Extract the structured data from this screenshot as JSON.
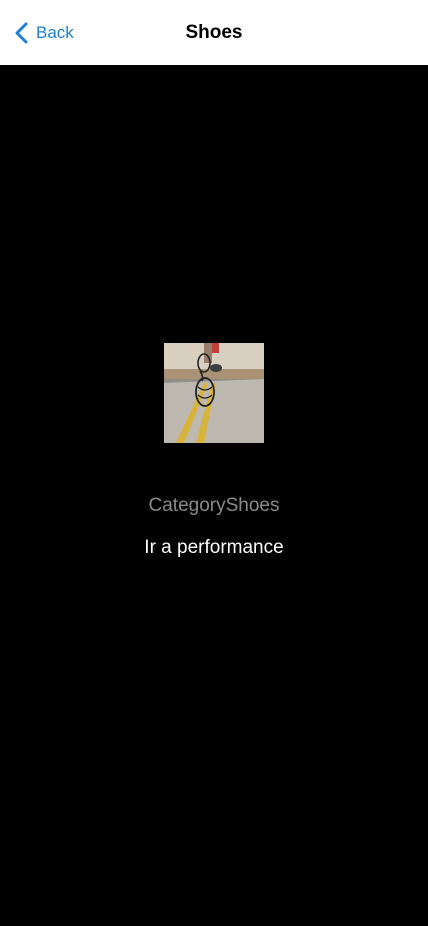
{
  "navbar": {
    "back_label": "Back",
    "title": "Shoes"
  },
  "product": {
    "category": "CategoryShoes",
    "title": "Ir a performance",
    "image_icon": "shoe-product-photo"
  },
  "colors": {
    "accent": "#1a7fd6",
    "background": "#000000",
    "navbar_bg": "#ffffff",
    "category_text": "#8a8a8a",
    "title_text": "#ffffff"
  }
}
